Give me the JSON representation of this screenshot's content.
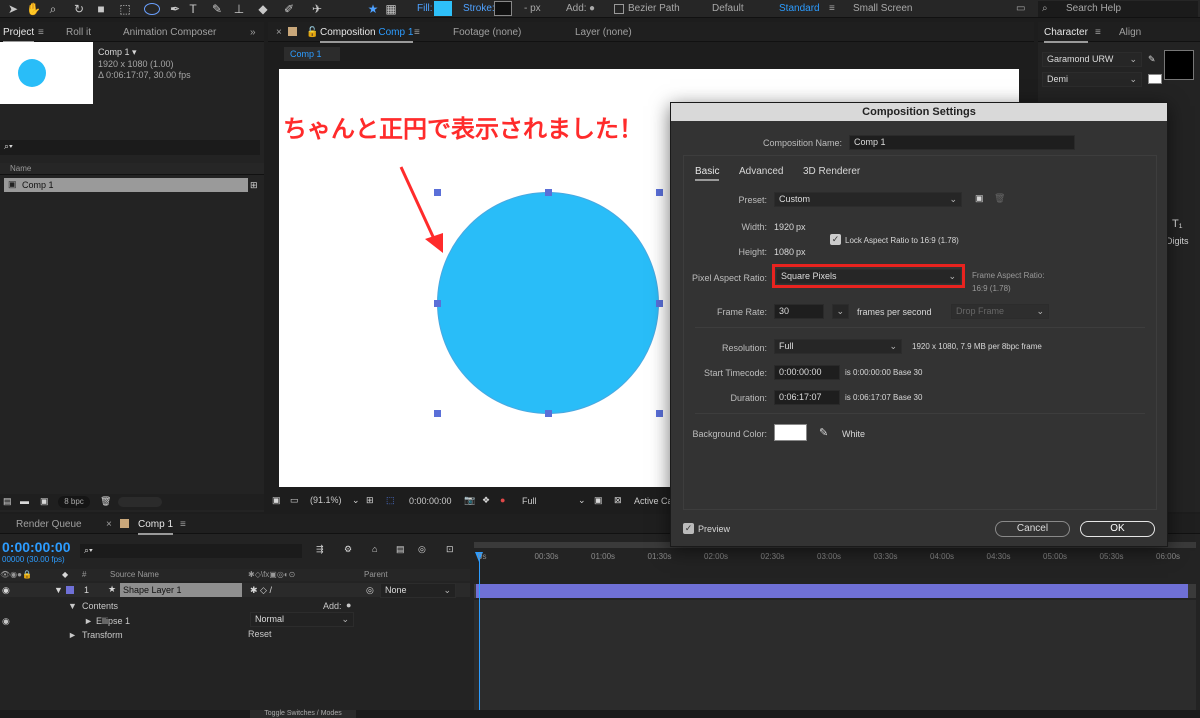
{
  "toolbar": {
    "fill_label": "Fill:",
    "stroke_label": "Stroke:",
    "stroke_px": "- px",
    "add_label": "Add:",
    "bezier_label": "Bezier Path",
    "workspaces": [
      "Default",
      "Standard",
      "Small Screen"
    ],
    "search_placeholder": "Search Help",
    "fill_color": "#2ec0f9"
  },
  "project_panel": {
    "tabs": [
      "Project",
      "Roll it",
      "Animation Composer"
    ],
    "comp_name": "Comp 1 ▾",
    "comp_info1": "1920 x 1080 (1.00)",
    "comp_info2": "Δ 0:06:17:07, 30.00 fps",
    "search_icon": "search-icon",
    "col_name": "Name",
    "items": [
      {
        "label": "Comp 1"
      }
    ],
    "bpc": "8 bpc"
  },
  "viewer": {
    "tabs": [
      "Composition",
      "Comp 1",
      "Footage (none)",
      "Layer (none)"
    ],
    "comp_tab_label": "Comp 1",
    "annotation": "ちゃんと正円で表示されました！",
    "zoom": "(91.1%)",
    "timecode": "0:00:00:00",
    "resolution": "Full",
    "active_camera": "Active Ca",
    "circle_color": "#29bdf8",
    "annotation_color": "#ff2b2b"
  },
  "character_panel": {
    "tabs": [
      "Character",
      "Align"
    ],
    "font": "Garamond URW",
    "style": "Demi",
    "digits": "Digits"
  },
  "dialog": {
    "title": "Composition Settings",
    "name_label": "Composition Name:",
    "name_value": "Comp 1",
    "tabs": [
      "Basic",
      "Advanced",
      "3D Renderer"
    ],
    "preset_label": "Preset:",
    "preset_value": "Custom",
    "width_label": "Width:",
    "width_value": "1920",
    "px": "px",
    "height_label": "Height:",
    "height_value": "1080",
    "lock_label": "Lock Aspect Ratio to 16:9 (1.78)",
    "par_label": "Pixel Aspect Ratio:",
    "par_value": "Square Pixels",
    "far_label": "Frame Aspect Ratio:",
    "far_value": "16:9 (1.78)",
    "framerate_label": "Frame Rate:",
    "framerate_value": "30",
    "fps_text": "frames per second",
    "drop_frame": "Drop Frame",
    "res_label": "Resolution:",
    "res_value": "Full",
    "res_info": "1920 x 1080, 7.9 MB per 8bpc frame",
    "start_label": "Start Timecode:",
    "start_value": "0:00:00:00",
    "start_info": "is 0:00:00:00  Base 30",
    "dur_label": "Duration:",
    "dur_value": "0:06:17:07",
    "dur_info": "is 0:06:17:07  Base 30",
    "bg_label": "Background Color:",
    "bg_name": "White",
    "preview": "Preview",
    "cancel": "Cancel",
    "ok": "OK",
    "highlight_color": "#e8231f"
  },
  "timeline": {
    "tabs": [
      "Render Queue",
      "Comp 1"
    ],
    "timecode": "0:00:00:00",
    "fps": "00000 (30.00 fps)",
    "col_source": "Source Name",
    "col_parent": "Parent",
    "layer_num": "1",
    "layer_name": "Shape Layer 1",
    "parent_value": "None",
    "contents": "Contents",
    "add": "Add:",
    "ellipse": "Ellipse 1",
    "blend": "Normal",
    "transform": "Transform",
    "reset": "Reset",
    "ruler": [
      "0s",
      "00:30s",
      "01:00s",
      "01:30s",
      "02:00s",
      "02:30s",
      "03:00s",
      "03:30s",
      "04:00s",
      "04:30s",
      "05:00s",
      "05:30s",
      "06:00s"
    ],
    "toggle": "Toggle Switches / Modes",
    "bar_color": "#6f70d6"
  }
}
